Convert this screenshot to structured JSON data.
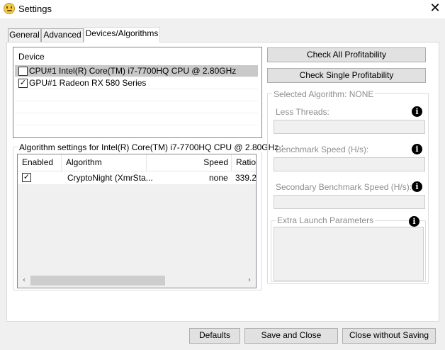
{
  "window": {
    "title": "Settings",
    "close_glyph": "✕"
  },
  "tabs": [
    {
      "label": "General",
      "active": false
    },
    {
      "label": "Advanced",
      "active": false
    },
    {
      "label": "Devices/Algorithms",
      "active": true
    }
  ],
  "devices": {
    "header": "Device",
    "items": [
      {
        "label": "CPU#1 Intel(R) Core(TM) i7-7700HQ CPU @ 2.80GHz",
        "checked": false,
        "selected": true
      },
      {
        "label": "GPU#1 Radeon RX 580 Series",
        "checked": true,
        "selected": false
      }
    ]
  },
  "algorithm_settings": {
    "group_title": "Algorithm settings for Intel(R) Core(TM) i7-7700HQ CPU @ 2.80GHz :",
    "columns": [
      "Enabled",
      "Algorithm",
      "Speed",
      "Ratio"
    ],
    "rows": [
      {
        "enabled": true,
        "algorithm": "CryptoNight (XmrSta...",
        "speed": "none",
        "ratio": "339.2"
      }
    ],
    "scroll_left": "‹",
    "scroll_right": "›"
  },
  "actions": {
    "check_all": "Check All Profitability",
    "check_single": "Check Single Profitability"
  },
  "selected_algorithm": {
    "group_title": "Selected Algorithm: NONE",
    "less_threads_label": "Less Threads:",
    "benchmark_speed_label": "Benchmark Speed (H/s):",
    "secondary_benchmark_label": "Secondary Benchmark Speed (H/s):",
    "extra_launch_label": "Extra Launch Parameters",
    "info_glyph": "i"
  },
  "footer": {
    "defaults": "Defaults",
    "save_close": "Save and Close",
    "close_no_save": "Close without Saving"
  },
  "colors": {
    "selected_row": "#c9c9c9",
    "disabled_text": "#8d8d8d",
    "button_face": "#e1e1e1"
  }
}
